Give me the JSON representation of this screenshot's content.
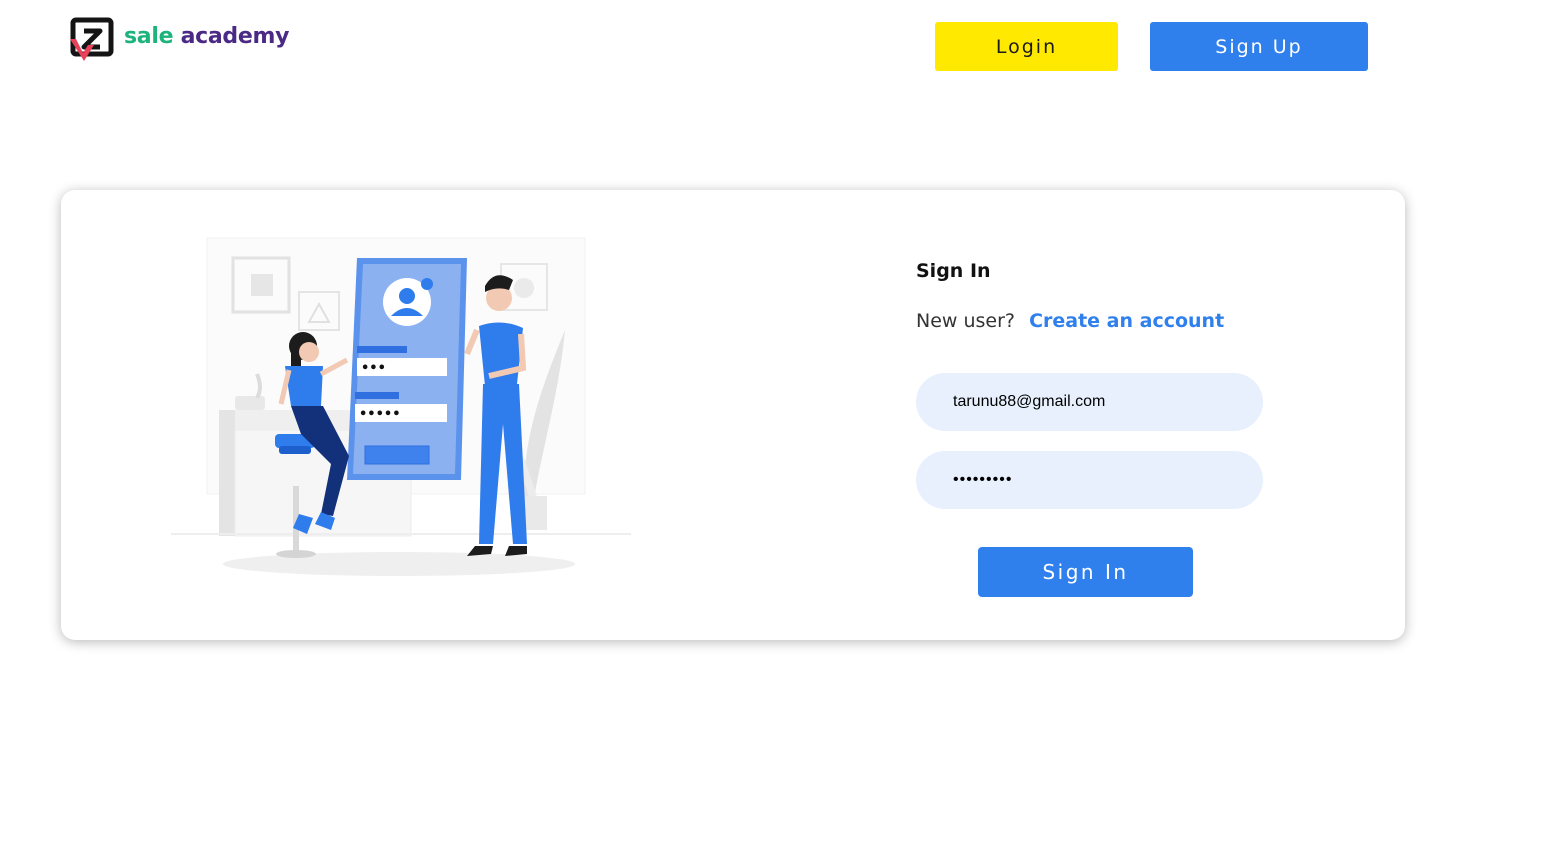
{
  "brand": {
    "name_part1": "sale",
    "name_part2": "academy",
    "logo_icon": "sale-academy-logo",
    "colors": {
      "green": "#1fb37c",
      "purple": "#4b2a86",
      "red": "#e8425a"
    }
  },
  "header": {
    "login_label": "Login",
    "signup_label": "Sign Up",
    "login_color": "#ffe900",
    "signup_color": "#2f80ed"
  },
  "signin": {
    "title": "Sign In",
    "new_user_text": "New user?",
    "create_account_link": "Create an account",
    "email_value": "tarunu88@gmail.com",
    "password_value": "•••••••••",
    "submit_label": "Sign In",
    "accent": "#2f80ed",
    "field_bg": "#e8f0fe"
  },
  "illustration": {
    "icon": "login-illustration",
    "password_dots_1": "•••",
    "password_dots_2": "•••••"
  }
}
